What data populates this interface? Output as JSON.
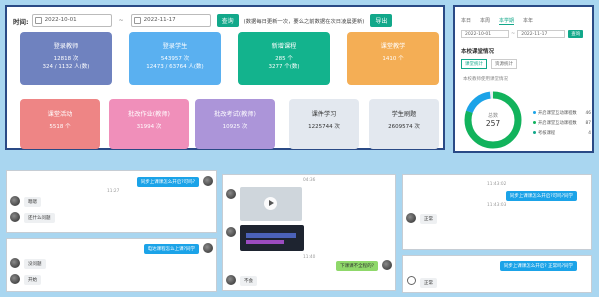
{
  "toolbar": {
    "time_label": "时间:",
    "start_date": "2022-10-01",
    "separator": "~",
    "end_date": "2022-11-17",
    "query_button": "查询",
    "hint": "(数据每日更新一次，要么之前数据在次日凌晨更新)",
    "export_button": "导出"
  },
  "cards": [
    {
      "title": "登录教师",
      "line1": "12818 次",
      "line2": "324 / 1132 人(数)",
      "color": "#6f82bf"
    },
    {
      "title": "登录学生",
      "line1": "543957 次",
      "line2": "12473 / 63764 人(数)",
      "color": "#5ab0f0"
    },
    {
      "title": "新增课程",
      "line1": "285 个",
      "line2": "3277 个(数)",
      "color": "#13b38d"
    },
    {
      "title": "课堂教学",
      "line1": "1410 个",
      "line2": "",
      "color": "#f4ae55"
    },
    {
      "title": "课堂活动",
      "line1": "5518 个",
      "line2": "",
      "color": "#ee8585"
    },
    {
      "title": "批改作业(教师)",
      "line1": "31994 次",
      "line2": "",
      "color": "#f08fba"
    },
    {
      "title": "批改考试(教师)",
      "line1": "10925 次",
      "line2": "",
      "color": "#ac95d9"
    },
    {
      "title": "课件学习",
      "line1": "1225744 次",
      "line2": "",
      "color": "#e3e8ef"
    },
    {
      "title": "学生刷题",
      "line1": "2609574 次",
      "line2": "",
      "color": "#e3e8ef"
    }
  ],
  "usage": {
    "tabs": [
      "本日",
      "本周",
      "本学期",
      "本年"
    ],
    "active_tab": 2,
    "date_from": "2022-10-01",
    "date_to": "2022-11-17",
    "search_button": "查询",
    "section_title": "本校课堂情况",
    "subtabs": [
      "课堂统计",
      "资源统计"
    ],
    "small_text": "本校教师使用课堂情况",
    "donut_label": "总数",
    "donut_value": "257",
    "legend": [
      {
        "label": "开启课堂互动课程数",
        "value": "46",
        "color": "#1ba3e8"
      },
      {
        "label": "开启课堂互动课程数",
        "value": "87",
        "color": "#12b35c"
      },
      {
        "label": "考核课程",
        "value": "4",
        "color": "#12a88a"
      }
    ]
  },
  "chats": {
    "c1": {
      "out": "同步上课课怎么开启?可吗?",
      "in1": "嗯嗯",
      "in2": "还什么问题",
      "time": "11:27"
    },
    "c2": {
      "out": "电达课程怎么上课?同学",
      "in1": "没问题",
      "in2": "开始",
      "time": ""
    },
    "c3": {
      "out": "下课课不全程的?",
      "in": "不会",
      "header": "04:36",
      "time": "11:40"
    },
    "c4": {
      "time1": "11:43:02",
      "out": "同步上课课怎么开启?可吗?同学",
      "time2": "11:43:03",
      "in": "正常"
    },
    "c5": {
      "out": "同步上课课怎么开启? 正常吗?同学",
      "in": "正常"
    }
  }
}
